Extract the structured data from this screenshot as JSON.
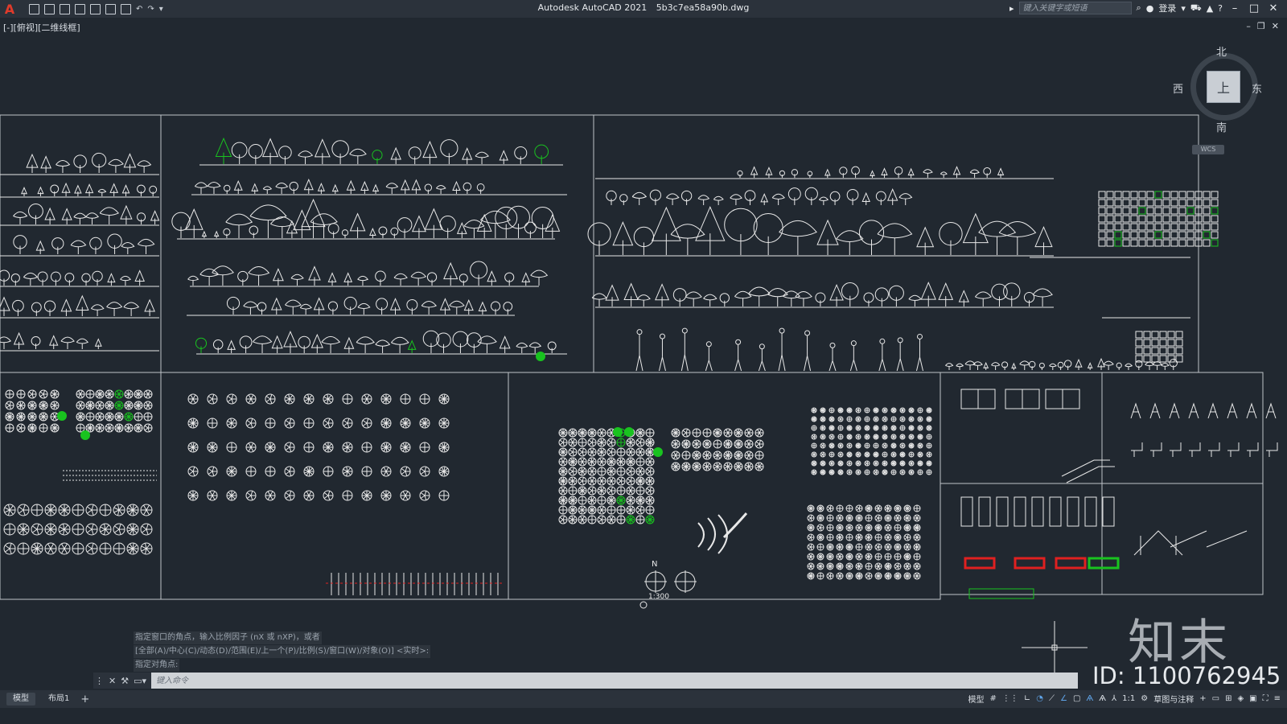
{
  "app": {
    "title": "Autodesk AutoCAD 2021",
    "filename": "5b3c7ea58a90b.dwg"
  },
  "search": {
    "placeholder": "键入关键字或短语"
  },
  "account": {
    "login": "登录"
  },
  "viewport_label": "[-][俯视][二维线框]",
  "viewcube": {
    "north": "北",
    "south": "南",
    "east": "东",
    "west": "西",
    "face": "上",
    "wcs": "WCS"
  },
  "command_history": [
    "指定窗口的角点，输入比例因子 (nX 或 nXP)，或者",
    "[全部(A)/中心(C)/动态(D)/范围(E)/上一个(P)/比例(S)/窗口(W)/对象(O)] <实时>:",
    "指定对角点:"
  ],
  "command_input": {
    "placeholder": "键入命令"
  },
  "layout_tabs": {
    "model": "模型",
    "layout1": "布局1",
    "add": "+"
  },
  "status": {
    "model": "模型",
    "scale": "1:1",
    "workspace": "草图与注释"
  },
  "drawing_notes": {
    "north_label": "N",
    "scale_label": "1:300"
  },
  "watermark": {
    "logo": "知末",
    "id": "ID: 1100762945"
  },
  "colors": {
    "background": "#212830",
    "linework": "#e8e8e8",
    "accent_green": "#19c31f",
    "accent_red": "#e02020"
  }
}
